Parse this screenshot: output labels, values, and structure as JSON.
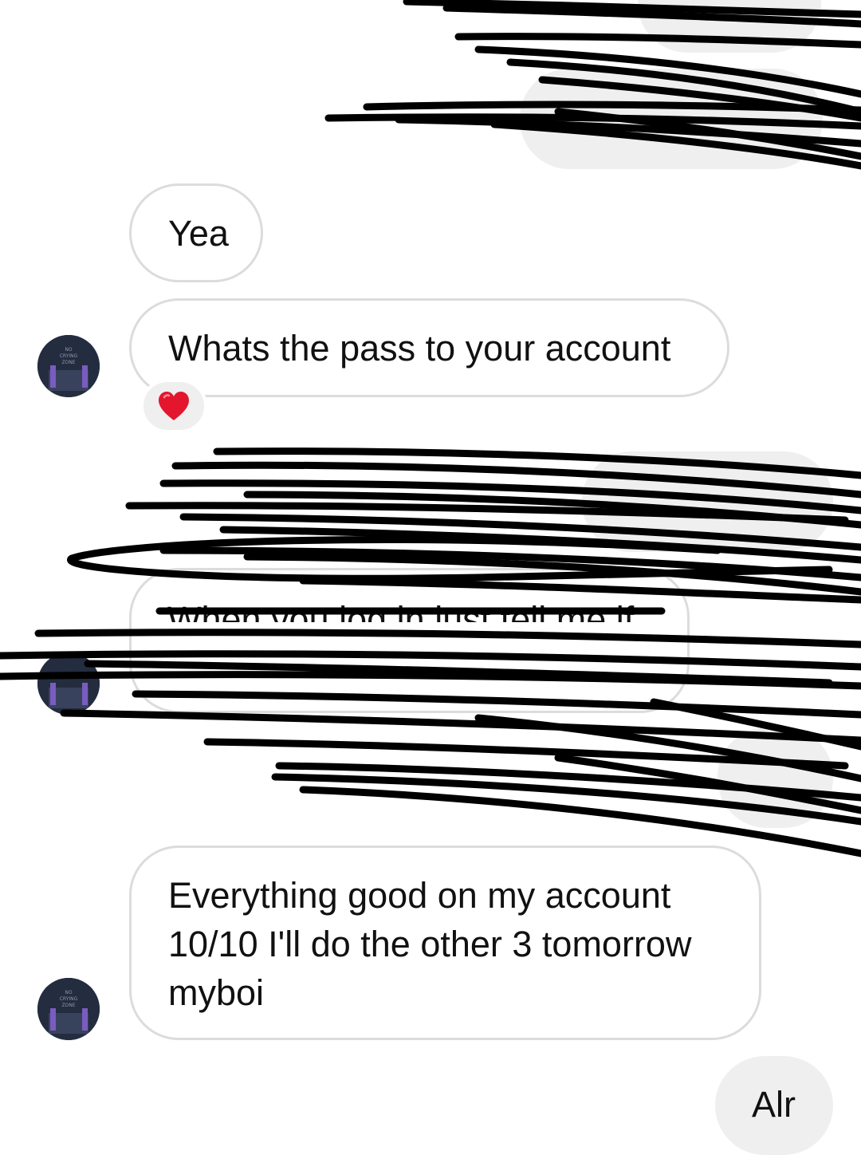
{
  "messages": {
    "yea": "Yea",
    "pass": "Whats the pass to your account",
    "pass_reaction": "heart-emoji",
    "everything_line1": "Everything good on my account",
    "everything_line2": "10/10 I'll do the other 3 tomorrow",
    "everything_line3": "myboi",
    "alr": "Alr"
  },
  "avatar": {
    "caption": "NO CRYING ZONE"
  },
  "colors": {
    "incoming_border": "#dcdcdc",
    "outgoing_bg": "#efefef",
    "redaction_ink": "#000000",
    "reaction_heart": "#e3162d"
  }
}
